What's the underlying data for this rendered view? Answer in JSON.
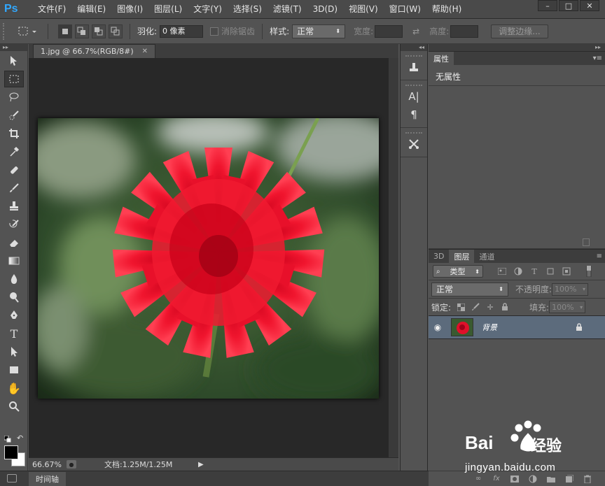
{
  "app": {
    "logo": "Ps"
  },
  "menu": [
    "文件(F)",
    "编辑(E)",
    "图像(I)",
    "图层(L)",
    "文字(Y)",
    "选择(S)",
    "滤镜(T)",
    "3D(D)",
    "视图(V)",
    "窗口(W)",
    "帮助(H)"
  ],
  "options": {
    "feather_label": "羽化:",
    "feather_value": "0 像素",
    "antialias_label": "消除锯齿",
    "style_label": "样式:",
    "style_value": "正常",
    "width_label": "宽度:",
    "height_label": "高度:",
    "refine_edge": "调整边缘..."
  },
  "document": {
    "tab_title": "1.jpg @ 66.7%(RGB/8#)",
    "zoom": "66.67%",
    "doc_size": "文档:1.25M/1.25M"
  },
  "timeline": {
    "tab": "时间轴"
  },
  "properties": {
    "tab": "属性",
    "empty": "无属性"
  },
  "layers": {
    "tabs": [
      "3D",
      "图层",
      "通道"
    ],
    "filter": "类型",
    "blend_mode": "正常",
    "opacity_label": "不透明度:",
    "opacity_value": "100%",
    "lock_label": "锁定:",
    "fill_label": "填充:",
    "fill_value": "100%",
    "items": [
      {
        "name": "背景"
      }
    ]
  },
  "watermark": {
    "url": "jingyan.baidu.com",
    "brand": "Bai",
    "brand2": "经验"
  }
}
